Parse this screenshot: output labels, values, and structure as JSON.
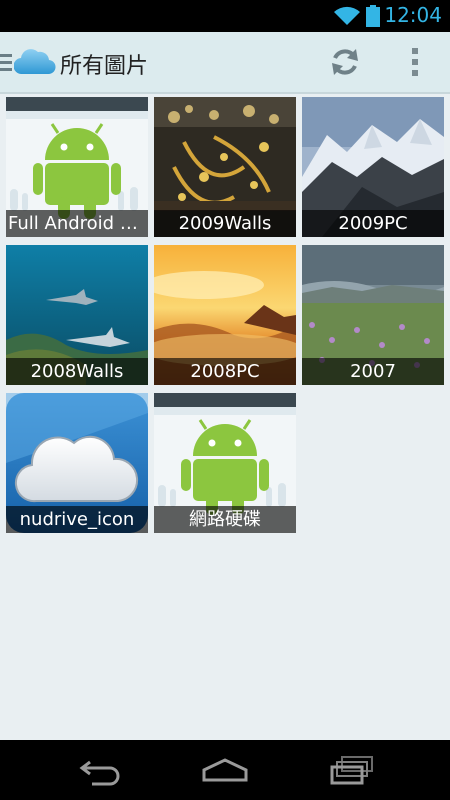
{
  "status_bar": {
    "time": "12:04",
    "icons": [
      "wifi-icon",
      "battery-icon"
    ],
    "accent_color": "#33b5e5"
  },
  "action_bar": {
    "title": "所有圖片",
    "icons": [
      "menu-icon",
      "cloud-logo-icon",
      "refresh-icon",
      "overflow-menu-icon"
    ]
  },
  "folders": [
    {
      "label": "Full Android o...",
      "thumbnail": "android-robot"
    },
    {
      "label": "2009Walls",
      "thumbnail": "gold-treasure-photo"
    },
    {
      "label": "2009PC",
      "thumbnail": "snowy-mountain-photo"
    },
    {
      "label": "2008Walls",
      "thumbnail": "underwater-sharks-photo"
    },
    {
      "label": "2008PC",
      "thumbnail": "golden-sunset-clouds-photo"
    },
    {
      "label": "2007",
      "thumbnail": "flower-meadow-photo"
    },
    {
      "label": "nudrive_icon",
      "thumbnail": "blue-cloud-icon"
    },
    {
      "label": "網路硬碟",
      "thumbnail": "android-robot"
    }
  ],
  "nav_bar": {
    "icons": [
      "back-icon",
      "home-icon",
      "recent-apps-icon"
    ]
  }
}
